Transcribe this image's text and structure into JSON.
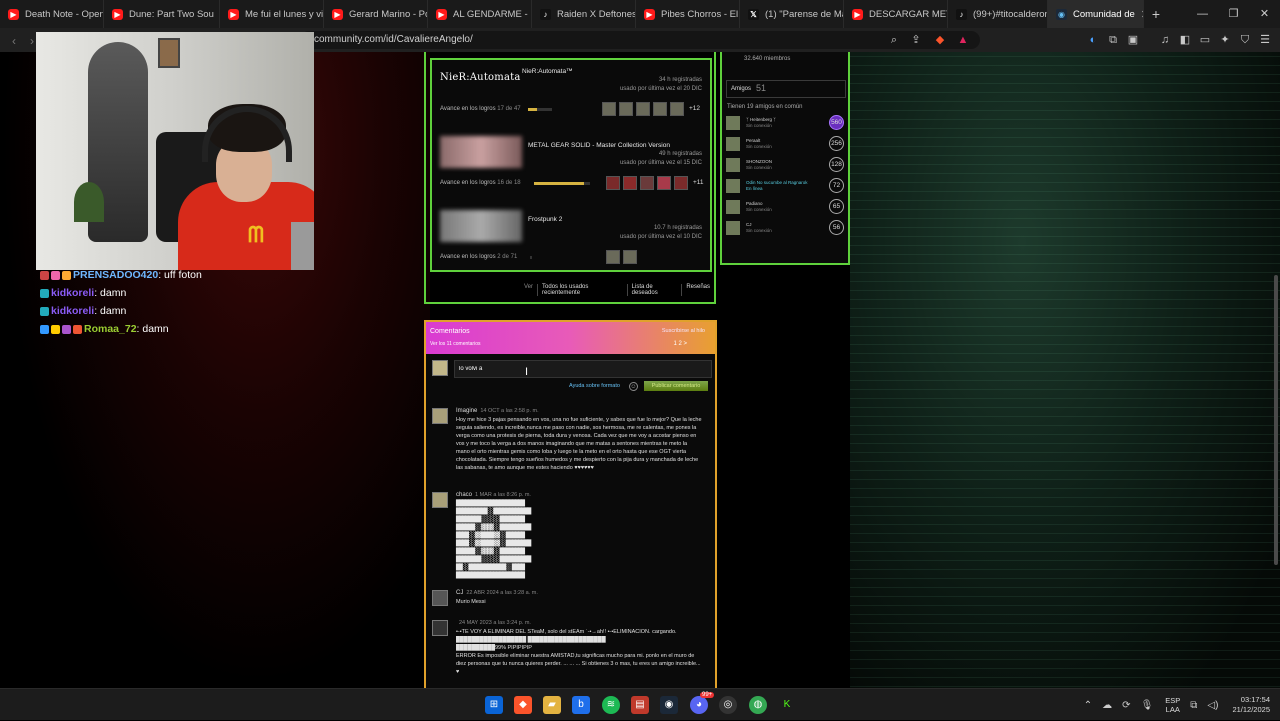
{
  "tabs": [
    {
      "label": "Death Note - Openi",
      "kind": "yt"
    },
    {
      "label": "Dune: Part Two Sou",
      "kind": "yt"
    },
    {
      "label": "Me fui el lunes y vi",
      "kind": "yt"
    },
    {
      "label": "Gerard Marino - Po",
      "kind": "yt"
    },
    {
      "label": "AL GENDARME - KA",
      "kind": "yt"
    },
    {
      "label": "Raiden X Deftones",
      "kind": "tk"
    },
    {
      "label": "Pibes Chorros - El p",
      "kind": "yt"
    },
    {
      "label": "(1) \"Parense de Ma",
      "kind": "x"
    },
    {
      "label": "DESCARGAR METAL",
      "kind": "yt"
    },
    {
      "label": "(99+)#titocalderon",
      "kind": "tk"
    },
    {
      "label": "Comunidad de",
      "kind": "st",
      "active": true
    }
  ],
  "address": {
    "url": "community.com/id/CavaliereAngelo/"
  },
  "games_panel": {
    "games": [
      {
        "name": "NieR:Automata™",
        "hours": "34 h registradas",
        "last_played": "usado por última vez el 20 DIC",
        "achievements_label": "Avance en los logros",
        "achievements_count": "17 de 47",
        "progress": 0.36,
        "more": "+12",
        "logo_text": "NieR:Automata"
      },
      {
        "name": "METAL GEAR SOLID - Master Collection Version",
        "hours": "49 h registradas",
        "last_played": "usado por última vez el 15 DIC",
        "achievements_label": "Avance en los logros",
        "achievements_count": "16 de 18",
        "progress": 0.89,
        "more": "+11"
      },
      {
        "name": "Frostpunk 2",
        "hours": "10.7 h registradas",
        "last_played": "usado por última vez el 10 DIC",
        "achievements_label": "Avance en los logros",
        "achievements_count": "2 de 71",
        "progress": 0.03,
        "more": ""
      }
    ],
    "links": [
      "Ver",
      "Todos los usados recientemente",
      "Lista de deseados",
      "Reseñas"
    ]
  },
  "friends_panel": {
    "members": "32.640 miembros",
    "amigos_label": "Amigos",
    "amigos_count": "51",
    "common_text": "Tienen 19 amigos en común",
    "friends": [
      {
        "name": "ᛉ Heitenberg ᛉ",
        "status": "Sin conexión",
        "level": "560",
        "online": false,
        "purple": true
      },
      {
        "name": "Peraalt",
        "status": "Sin conexión",
        "level": "256",
        "online": false,
        "purple": false
      },
      {
        "name": "SHONZOON",
        "status": "Sin conexión",
        "level": "128",
        "online": false,
        "purple": false
      },
      {
        "name": "Odin No sucumbe al Ragnarok",
        "status": "En línea",
        "level": "72",
        "online": true,
        "purple": false
      },
      {
        "name": "Padiano",
        "status": "Sin conexión",
        "level": "65",
        "online": false,
        "purple": false
      },
      {
        "name": "CJ",
        "status": "Sin conexión",
        "level": "56",
        "online": false,
        "purple": false
      }
    ]
  },
  "comments": {
    "title": "Comentarios",
    "subscribe": "Suscribirse al hilo",
    "view_all": "Ver los 11 comentarios",
    "pager": "1  2  >",
    "input_value": "lo volvi a",
    "format_help": "Ayuda sobre formato",
    "post_button": "Publicar comentario",
    "items": [
      {
        "author": "Imagine",
        "date": "14 OCT a las 2:58 p. m.",
        "text": "Hoy me hice 3 pajas pensando en vos, una no fue suficiente, y sabes que fue lo mejor? Que la leche seguia saliendo, es increible,nunca me paso con nadie, sos hermosa, me re calentas, me pones la verga como una protesis de pierna, toda dura y venosa. Cada vez que me voy a acostar pienso en vos y me toco la verga a dos manos imaginando que me matas a sentones mientras te meto la mano el orto mientras gemis como loba y luego te la meto en el orto hasta que ese OGT vierta chocolatada. Siempre tengo sueños humedos y me despierto con la pija dura y manchada de leche las sabanas, te amo aunque me estes haciendo ♥♥♥♥♥♥"
      },
      {
        "author": "chaco",
        "date": "1 MAR a las 8:26 p. m.",
        "text": "██████████████████████\n██████████░░████████████\n████████░░░░░░████████\n██████░░▓▓▓▓░░██████████\n████░░▓▓████▓▓░░██████\n████░░▓▓████▓▓░░████████\n██████░░▓▓▓▓░░████████\n████████░░░░░░██████████\n██░░████████████░░████\n██████████████████████"
      },
      {
        "author": "CJ",
        "date": "22 ABR 2024 a las 3:28 a. m.",
        "text": "Murio Messi"
      },
      {
        "author": "",
        "date": "24 MAY 2023 a las 3:24 p. m.",
        "text": "•-•TE VOY A ELIMINAR DEL STeaM, solo del stEAm ˙-•→ah!! •-•ELIMINACION. cargando.\n██████████████████ ████████████████████\n██████████99% PIPIPIPIP\nERROR Es imposible eliminar nuestra AMISTAD,tu significas mucho para mi. ponlo en el muro de diez personas que tu nunca quieres perder. ... ... ... Si obtienes 3 o mas, tu eres un amigo increible... ♥"
      }
    ]
  },
  "chat": [
    {
      "user": "PRENSADOO420",
      "message": "uff foton",
      "color": "#6fb7ff"
    },
    {
      "user": "kidkoreli",
      "message": "damn",
      "color": "#8b5cf6"
    },
    {
      "user": "kidkoreli",
      "message": "damn",
      "color": "#8b5cf6"
    },
    {
      "user": "Romaa_72",
      "message": "damn",
      "color": "#9acd32"
    }
  ],
  "taskbar": {
    "lang_top": "ESP",
    "lang_bottom": "LAA",
    "time": "03:17:54",
    "date": "21/12/2025",
    "discord_badge": "99+"
  },
  "colors": {
    "steam_green": "#5fd13c",
    "comment_border": "#e0a12b",
    "header_pink": "#d93bd2"
  }
}
